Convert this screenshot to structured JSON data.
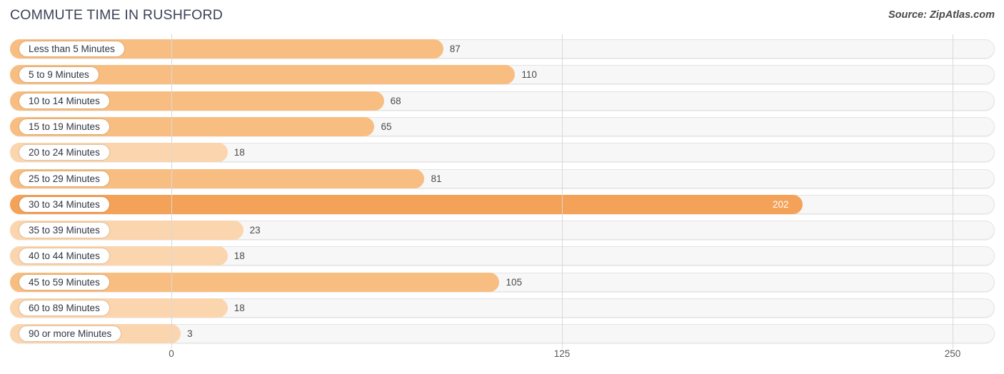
{
  "header": {
    "title": "COMMUTE TIME IN RUSHFORD",
    "source": "Source: ZipAtlas.com"
  },
  "colors": {
    "bar_default": "#f8be81",
    "bar_max": "#f5a259",
    "bar_low": "#fbd5ae",
    "track": "#f7f7f7",
    "track_border": "#e3e3e3",
    "gridline": "#d8d8d8",
    "title": "#3c4257",
    "value_text": "#4a4a4a",
    "value_text_inside": "#ffffff"
  },
  "axis": {
    "ticks": [
      "0",
      "125",
      "250"
    ],
    "min": 0,
    "max": 250
  },
  "chart_data": {
    "type": "bar",
    "orientation": "horizontal",
    "title": "COMMUTE TIME IN RUSHFORD",
    "subtitle": "Source: ZipAtlas.com",
    "xlabel": "",
    "ylabel": "",
    "xlim": [
      0,
      250
    ],
    "xticks": [
      0,
      125,
      250
    ],
    "grid": true,
    "legend": false,
    "categories": [
      "Less than 5 Minutes",
      "5 to 9 Minutes",
      "10 to 14 Minutes",
      "15 to 19 Minutes",
      "20 to 24 Minutes",
      "25 to 29 Minutes",
      "30 to 34 Minutes",
      "35 to 39 Minutes",
      "40 to 44 Minutes",
      "45 to 59 Minutes",
      "60 to 89 Minutes",
      "90 or more Minutes"
    ],
    "values": [
      87,
      110,
      68,
      65,
      18,
      81,
      202,
      23,
      18,
      105,
      18,
      3
    ],
    "value_labels": [
      "87",
      "110",
      "68",
      "65",
      "18",
      "81",
      "202",
      "23",
      "18",
      "105",
      "18",
      "3"
    ]
  },
  "rows": [
    {
      "label": "Less than 5 Minutes",
      "value": 87,
      "value_label": "87",
      "style": "default",
      "label_inside": false
    },
    {
      "label": "5 to 9 Minutes",
      "value": 110,
      "value_label": "110",
      "style": "default",
      "label_inside": false
    },
    {
      "label": "10 to 14 Minutes",
      "value": 68,
      "value_label": "68",
      "style": "default",
      "label_inside": false
    },
    {
      "label": "15 to 19 Minutes",
      "value": 65,
      "value_label": "65",
      "style": "default",
      "label_inside": false
    },
    {
      "label": "20 to 24 Minutes",
      "value": 18,
      "value_label": "18",
      "style": "low",
      "label_inside": false
    },
    {
      "label": "25 to 29 Minutes",
      "value": 81,
      "value_label": "81",
      "style": "default",
      "label_inside": false
    },
    {
      "label": "30 to 34 Minutes",
      "value": 202,
      "value_label": "202",
      "style": "max",
      "label_inside": true
    },
    {
      "label": "35 to 39 Minutes",
      "value": 23,
      "value_label": "23",
      "style": "low",
      "label_inside": false
    },
    {
      "label": "40 to 44 Minutes",
      "value": 18,
      "value_label": "18",
      "style": "low",
      "label_inside": false
    },
    {
      "label": "45 to 59 Minutes",
      "value": 105,
      "value_label": "105",
      "style": "default",
      "label_inside": false
    },
    {
      "label": "60 to 89 Minutes",
      "value": 18,
      "value_label": "18",
      "style": "low",
      "label_inside": false
    },
    {
      "label": "90 or more Minutes",
      "value": 3,
      "value_label": "3",
      "style": "low",
      "label_inside": false
    }
  ]
}
